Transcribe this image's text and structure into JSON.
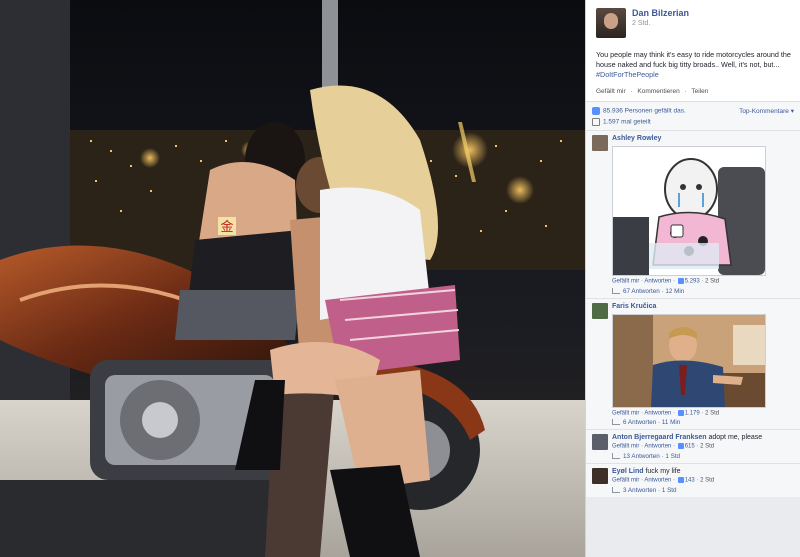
{
  "post": {
    "author": "Dan Bilzerian",
    "time": "2 Std.",
    "text": "You people may think it's easy to ride motorcycles around the house naked and fuck big titty broads.. Well, it's not, but...",
    "hashtag": "#DoItForThePeople",
    "actions": [
      "Gefällt mir",
      "·",
      "Kommentieren",
      "·",
      "Teilen"
    ]
  },
  "stats": {
    "likes": "85.936 Personen gefällt das.",
    "sort": "Top-Kommentare ▾",
    "shares": "1.597 mal geteilt"
  },
  "comments": [
    {
      "name": "Ashley Rowley",
      "text": "",
      "like": "Gefällt mir",
      "reply": "Antworten",
      "count": "5.293",
      "time": "2 Std",
      "replies": "67 Antworten · 12 Min"
    },
    {
      "name": "Faris Kručica",
      "text": "",
      "like": "Gefällt mir",
      "reply": "Antworten",
      "count": "1.179",
      "time": "2 Std",
      "replies": "6 Antworten · 11 Min"
    },
    {
      "name": "Anton Bjerregaard Franksen",
      "text": "adopt me, please",
      "like": "Gefällt mir",
      "reply": "Antworten",
      "count": "615",
      "time": "2 Std",
      "replies": "13 Antworten · 1 Std"
    },
    {
      "name": "Eyøl Lind",
      "text": "fuck my life",
      "like": "Gefällt mir",
      "reply": "Antworten",
      "count": "143",
      "time": "2 Std",
      "replies": "3 Antworten · 1 Std"
    }
  ],
  "photo": {
    "stamp": "金"
  },
  "colors": {
    "fb_blue": "#3b5998",
    "panel_bg": "#e9ebee",
    "text": "#1d2129",
    "meta": "#90949c"
  }
}
